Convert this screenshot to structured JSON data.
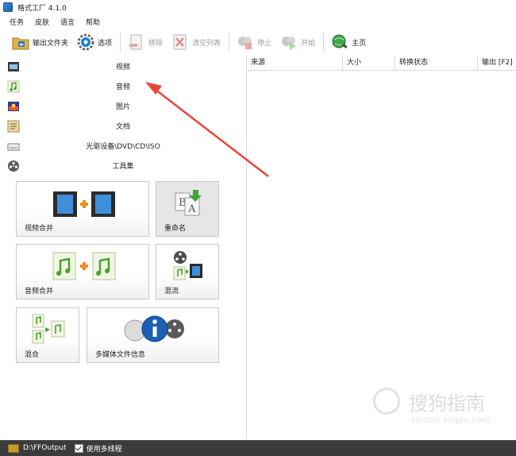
{
  "window": {
    "title": "格式工厂 4.1.0"
  },
  "menu": [
    "任务",
    "皮肤",
    "语言",
    "帮助"
  ],
  "toolbar": {
    "output_folder": "输出文件夹",
    "options": "选项",
    "remove": "移除",
    "clear_list": "清空列表",
    "stop": "停止",
    "start": "开始",
    "home": "主页"
  },
  "categories": [
    "视频",
    "音频",
    "图片",
    "文档",
    "光驱设备\\DVD\\CD\\ISO",
    "工具集"
  ],
  "tools": {
    "video_merge": "视频合并",
    "rename": "重命名",
    "audio_merge": "音频合并",
    "remux": "混流",
    "mix": "混合",
    "media_info": "多媒体文件信息"
  },
  "grid_columns": [
    "来源",
    "大小",
    "转换状态",
    "输出 [F2]"
  ],
  "status": {
    "output_path": "D:\\FFOutput",
    "multithread": "使用多线程"
  },
  "watermark": {
    "brand": "搜狗指南",
    "url": "zhinan.sogou.com"
  },
  "colors": {
    "annotation_arrow": "#e8453c",
    "statusbar": "#3b3b3b",
    "accent": "#1b7fd1"
  }
}
